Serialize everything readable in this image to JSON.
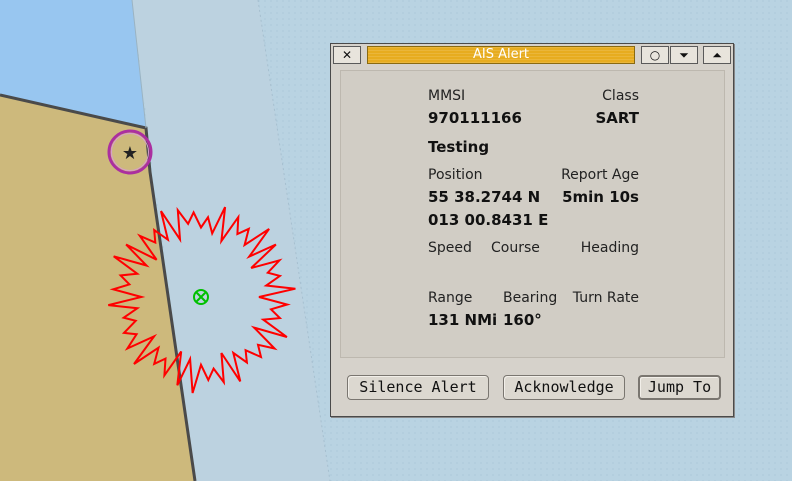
{
  "dialog": {
    "title": "AIS Alert",
    "controls": {
      "close": "✕",
      "sticky": "○",
      "shade": "⏷",
      "maximize": "⏶"
    },
    "labels": {
      "mmsi": "MMSI",
      "class": "Class",
      "position": "Position",
      "report_age": "Report Age",
      "speed": "Speed",
      "course": "Course",
      "heading": "Heading",
      "range": "Range",
      "bearing": "Bearing",
      "turn_rate": "Turn Rate"
    },
    "values": {
      "mmsi": "970111166",
      "class": "SART",
      "name": "Testing",
      "lat": "55 38.2744 N",
      "lon": "013 00.8431 E",
      "report_age": "5min 10s",
      "range": "131 NMi",
      "bearing": "160°"
    },
    "buttons": {
      "silence": "Silence Alert",
      "acknowledge": "Acknowledge",
      "jump": "Jump To"
    }
  },
  "map": {
    "colors": {
      "deep_water": "#b9d3e2",
      "shallow_water": "#98c6f0",
      "land": "#cdb97c",
      "coastline": "#4a4a4a",
      "target_ring": "#ab2fa0",
      "sart_symbol": "#00c000",
      "alert_burst": "#ff0000"
    },
    "icons": [
      "star-icon",
      "sart-target-icon"
    ]
  }
}
